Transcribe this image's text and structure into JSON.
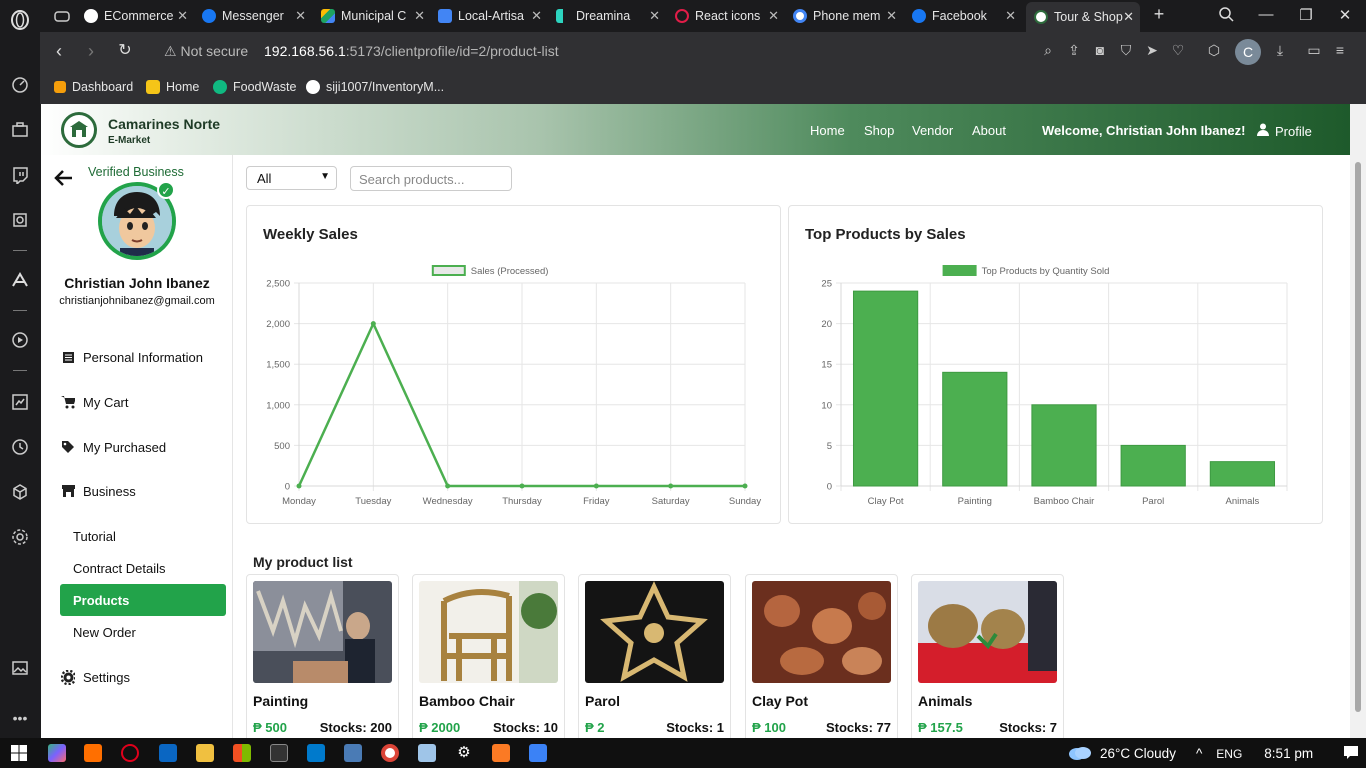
{
  "browser": {
    "tabs": [
      {
        "label": "ECommerce",
        "color": "#24292e"
      },
      {
        "label": "Messenger",
        "color": "#1877f2"
      },
      {
        "label": "Municipal C",
        "color": "#1ea362"
      },
      {
        "label": "Local-Artisa",
        "color": "#4285f4"
      },
      {
        "label": "Dreamina",
        "color": "#2dd4bf"
      },
      {
        "label": "React icons",
        "color": "#e11d48"
      },
      {
        "label": "Phone mem",
        "color": "#ffffff"
      },
      {
        "label": "Facebook",
        "color": "#1877f2"
      },
      {
        "label": "Tour & Shop",
        "color": "#2d6b3c"
      }
    ],
    "address": {
      "security": "Not secure",
      "host": "192.168.56.1",
      "path": ":5173/clientprofile/id=2/product-list"
    },
    "bookmarks": [
      {
        "label": "Dashboard",
        "color": "#f59e0b"
      },
      {
        "label": "Home",
        "color": "#f5c518"
      },
      {
        "label": "FoodWaste",
        "color": "#10b981"
      },
      {
        "label": "siji1007/InventoryM...",
        "color": "#ffffff"
      }
    ],
    "profile_initial": "C"
  },
  "header": {
    "brand_name": "Camarines Norte",
    "brand_sub": "E-Market",
    "nav": [
      "Home",
      "Shop",
      "Vendor",
      "About"
    ],
    "welcome": "Welcome, Christian John Ibanez!",
    "profile_label": "Profile"
  },
  "sidebar": {
    "verified": "Verified Business",
    "name": "Christian John Ibanez",
    "email": "christianjohnibanez@gmail.com",
    "menu": {
      "personal": "Personal Information",
      "cart": "My Cart",
      "purchased": "My Purchased",
      "business": "Business",
      "settings": "Settings"
    },
    "business_sub": [
      "Tutorial",
      "Contract Details",
      "Products",
      "New Order"
    ]
  },
  "filters": {
    "category": "All",
    "search_placeholder": "Search products..."
  },
  "weekly": {
    "title": "Weekly Sales"
  },
  "top": {
    "title": "Top Products by Sales"
  },
  "chart_data": [
    {
      "type": "line",
      "title": "Weekly Sales",
      "legend": "Sales (Processed)",
      "categories": [
        "Monday",
        "Tuesday",
        "Wednesday",
        "Thursday",
        "Friday",
        "Saturday",
        "Sunday"
      ],
      "values": [
        0,
        2000,
        0,
        0,
        0,
        0,
        0
      ],
      "ylim": [
        0,
        2500
      ],
      "yticks": [
        "0",
        "500",
        "1,000",
        "1,500",
        "2,000",
        "2,500"
      ],
      "color": "#4caf50",
      "grid": true,
      "legend_position": "top"
    },
    {
      "type": "bar",
      "title": "Top Products by Sales",
      "legend": "Top Products by Quantity Sold",
      "categories": [
        "Clay Pot",
        "Painting",
        "Bamboo Chair",
        "Parol",
        "Animals"
      ],
      "values": [
        24,
        14,
        10,
        5,
        3
      ],
      "ylim": [
        0,
        25
      ],
      "yticks": [
        "0",
        "5",
        "10",
        "15",
        "20",
        "25"
      ],
      "color": "#4caf50",
      "grid": true,
      "legend_position": "top"
    }
  ],
  "product_list": {
    "title": "My product list",
    "stock_label": "Stocks: ",
    "items": [
      {
        "name": "Painting",
        "price": "₱ 500",
        "stocks": "Stocks: 200"
      },
      {
        "name": "Bamboo Chair",
        "price": "₱ 2000",
        "stocks": "Stocks: 10"
      },
      {
        "name": "Parol",
        "price": "₱ 2",
        "stocks": "Stocks: 1"
      },
      {
        "name": "Clay Pot",
        "price": "₱ 100",
        "stocks": "Stocks: 77"
      },
      {
        "name": "Animals",
        "price": "₱ 157.5",
        "stocks": "Stocks: 7"
      }
    ]
  },
  "taskbar": {
    "weather": "26°C Cloudy",
    "lang": "ENG",
    "time": "8:51 pm"
  }
}
